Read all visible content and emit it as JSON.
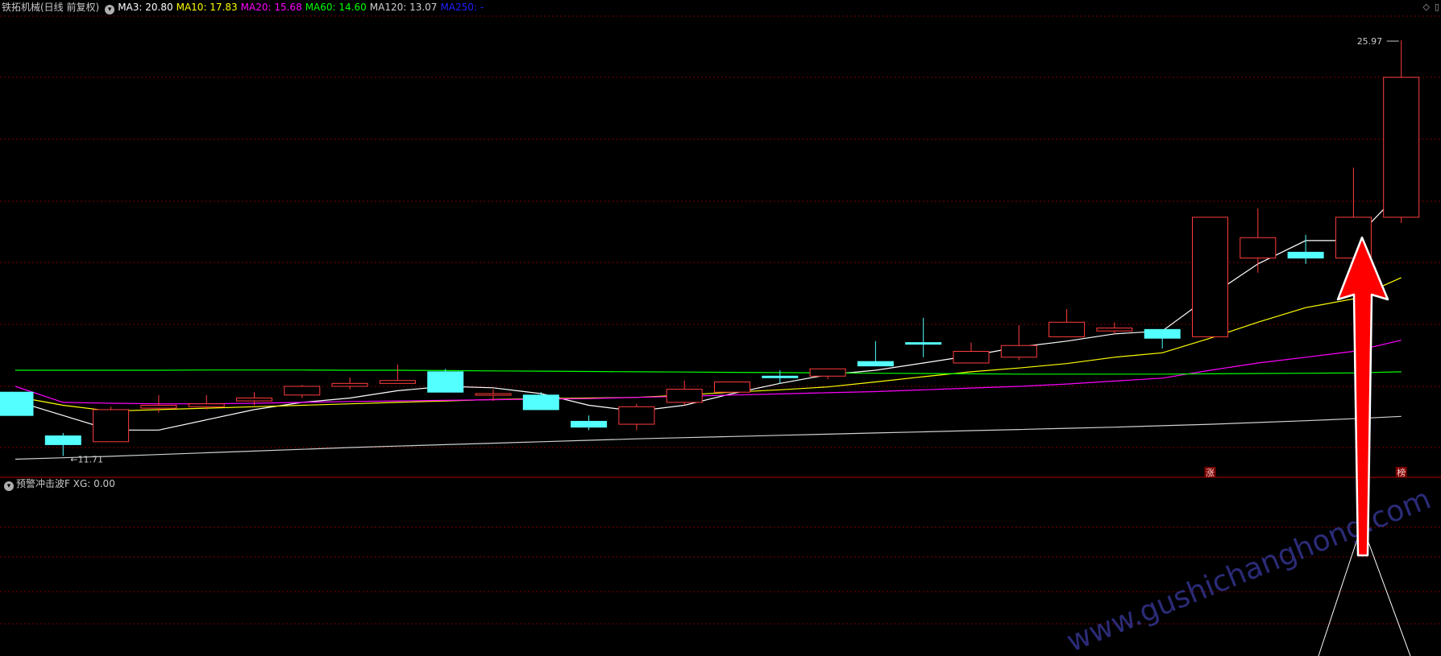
{
  "header": {
    "title": "铁拓机械(日线 前复权)",
    "ma_items": [
      {
        "label": "MA3: 20.80",
        "color": "#ffffff"
      },
      {
        "label": "MA10: 17.83",
        "color": "#ffff00"
      },
      {
        "label": "MA20: 15.68",
        "color": "#ff00ff"
      },
      {
        "label": "MA60: 14.60",
        "color": "#00ff00"
      },
      {
        "label": "MA120: 13.07",
        "color": "#d0d0d0"
      },
      {
        "label": "MA250: -",
        "color": "#0000ff"
      }
    ]
  },
  "sub": {
    "indicator_name": "预警冲击波F",
    "value_label": "XG: 0.00"
  },
  "icons": [
    "diamond-icon",
    "window-icon"
  ],
  "watermark": "www.gushichanghong.com",
  "chart_data": {
    "type": "candlestick",
    "y_range": [
      11.2,
      26.8
    ],
    "max_label": "25.97",
    "min_label": "11.71",
    "colors": {
      "up": "#ff3c3c",
      "down": "#54ffff",
      "grid": "#7a0000",
      "arrow": "#ff0000"
    },
    "candles": [
      {
        "o": 13.9,
        "c": 13.1,
        "h": 13.9,
        "l": 13.1
      },
      {
        "o": 12.4,
        "c": 12.1,
        "h": 12.5,
        "l": 11.71
      },
      {
        "o": 12.2,
        "c": 13.3,
        "h": 13.4,
        "l": 12.2
      },
      {
        "o": 13.35,
        "c": 13.45,
        "h": 13.8,
        "l": 13.2
      },
      {
        "o": 13.4,
        "c": 13.5,
        "h": 13.8,
        "l": 13.3
      },
      {
        "o": 13.6,
        "c": 13.7,
        "h": 13.9,
        "l": 13.45
      },
      {
        "o": 13.8,
        "c": 14.1,
        "h": 14.15,
        "l": 13.7
      },
      {
        "o": 14.1,
        "c": 14.2,
        "h": 14.4,
        "l": 14.0
      },
      {
        "o": 14.2,
        "c": 14.3,
        "h": 14.85,
        "l": 14.2
      },
      {
        "o": 14.6,
        "c": 13.9,
        "h": 14.7,
        "l": 13.9
      },
      {
        "o": 13.8,
        "c": 13.85,
        "h": 14.0,
        "l": 13.6
      },
      {
        "o": 13.8,
        "c": 13.3,
        "h": 13.9,
        "l": 13.3
      },
      {
        "o": 12.9,
        "c": 12.7,
        "h": 13.1,
        "l": 12.6
      },
      {
        "o": 12.8,
        "c": 13.4,
        "h": 13.5,
        "l": 12.6
      },
      {
        "o": 13.55,
        "c": 14.0,
        "h": 14.3,
        "l": 13.45
      },
      {
        "o": 13.9,
        "c": 14.25,
        "h": 14.25,
        "l": 13.9
      },
      {
        "o": 14.45,
        "c": 14.42,
        "h": 14.65,
        "l": 14.2
      },
      {
        "o": 14.45,
        "c": 14.7,
        "h": 14.7,
        "l": 14.35
      },
      {
        "o": 14.95,
        "c": 14.8,
        "h": 15.65,
        "l": 14.8
      },
      {
        "o": 15.6,
        "c": 15.58,
        "h": 16.45,
        "l": 15.1
      },
      {
        "o": 14.9,
        "c": 15.3,
        "h": 15.6,
        "l": 14.9
      },
      {
        "o": 15.1,
        "c": 15.5,
        "h": 16.2,
        "l": 15.0
      },
      {
        "o": 15.8,
        "c": 16.3,
        "h": 16.75,
        "l": 15.8
      },
      {
        "o": 16.0,
        "c": 16.1,
        "h": 16.3,
        "l": 15.9
      },
      {
        "o": 16.05,
        "c": 15.75,
        "h": 16.05,
        "l": 15.4
      },
      {
        "o": 15.8,
        "c": 19.9,
        "h": 19.9,
        "l": 15.8
      },
      {
        "o": 18.5,
        "c": 19.2,
        "h": 20.2,
        "l": 18.0
      },
      {
        "o": 18.7,
        "c": 18.5,
        "h": 19.3,
        "l": 18.3
      },
      {
        "o": 18.5,
        "c": 19.9,
        "h": 21.6,
        "l": 18.5
      },
      {
        "o": 19.9,
        "c": 24.7,
        "h": 25.97,
        "l": 19.7
      }
    ],
    "ma_lines": [
      {
        "name": "MA3",
        "color": "#ffffff",
        "values": [
          13.6,
          13.1,
          12.6,
          12.6,
          12.95,
          13.3,
          13.55,
          13.7,
          13.95,
          14.1,
          14.05,
          13.85,
          13.45,
          13.25,
          13.45,
          13.85,
          14.2,
          14.5,
          14.65,
          14.9,
          15.15,
          15.45,
          15.65,
          15.9,
          16.0,
          17.2,
          18.3,
          19.1,
          19.1,
          20.8
        ]
      },
      {
        "name": "MA10",
        "color": "#ffff00",
        "values": [
          13.75,
          13.45,
          13.25,
          13.3,
          13.35,
          13.4,
          13.45,
          13.5,
          13.55,
          13.6,
          13.65,
          13.68,
          13.7,
          13.72,
          13.8,
          13.9,
          13.98,
          14.08,
          14.25,
          14.43,
          14.6,
          14.73,
          14.88,
          15.1,
          15.25,
          15.75,
          16.3,
          16.8,
          17.1,
          17.83
        ]
      },
      {
        "name": "MA20",
        "color": "#ff00ff",
        "values": [
          14.1,
          13.55,
          13.52,
          13.5,
          13.5,
          13.52,
          13.55,
          13.58,
          13.6,
          13.62,
          13.64,
          13.66,
          13.68,
          13.72,
          13.76,
          13.8,
          13.84,
          13.88,
          13.92,
          13.98,
          14.04,
          14.1,
          14.18,
          14.28,
          14.38,
          14.65,
          14.9,
          15.1,
          15.3,
          15.68
        ]
      },
      {
        "name": "MA60",
        "color": "#00ff00",
        "values": [
          14.65,
          14.65,
          14.65,
          14.65,
          14.66,
          14.66,
          14.66,
          14.65,
          14.65,
          14.64,
          14.63,
          14.62,
          14.61,
          14.6,
          14.59,
          14.58,
          14.57,
          14.56,
          14.55,
          14.54,
          14.53,
          14.52,
          14.52,
          14.52,
          14.52,
          14.53,
          14.54,
          14.55,
          14.56,
          14.6
        ]
      },
      {
        "name": "MA120",
        "color": "#d0d0d0",
        "values": [
          11.6,
          11.65,
          11.7,
          11.76,
          11.82,
          11.88,
          11.94,
          12.0,
          12.05,
          12.1,
          12.15,
          12.2,
          12.25,
          12.3,
          12.34,
          12.38,
          12.42,
          12.46,
          12.5,
          12.54,
          12.58,
          12.62,
          12.66,
          12.7,
          12.75,
          12.8,
          12.86,
          12.92,
          12.99,
          13.07
        ]
      }
    ],
    "signal_labels": [
      {
        "index": 25,
        "text": "涨"
      },
      {
        "index": 29,
        "text": "榜"
      }
    ]
  }
}
